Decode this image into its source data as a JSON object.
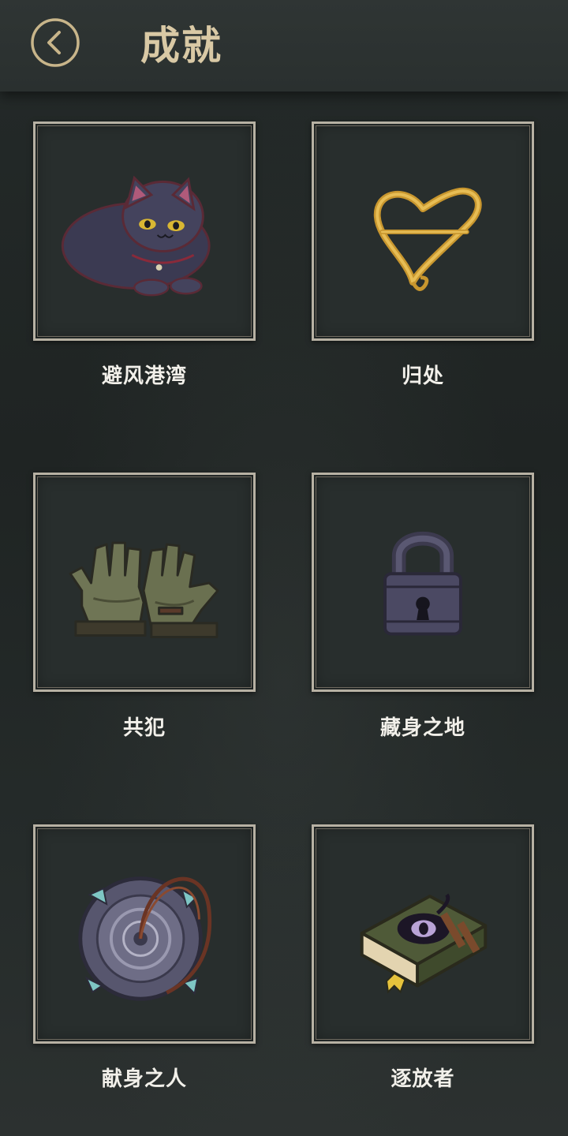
{
  "header": {
    "title": "成就",
    "back_icon": "chevron-left-icon"
  },
  "colors": {
    "accent_gold": "#d9c9a5",
    "tile_border": "#b7b1a3",
    "background": "#222827"
  },
  "achievements": [
    {
      "label": "避风港湾",
      "icon": "cat-icon"
    },
    {
      "label": "归处",
      "icon": "heart-pin-icon"
    },
    {
      "label": "共犯",
      "icon": "gloves-icon"
    },
    {
      "label": "藏身之地",
      "icon": "padlock-icon"
    },
    {
      "label": "献身之人",
      "icon": "amulet-icon"
    },
    {
      "label": "逐放者",
      "icon": "eye-book-icon"
    }
  ]
}
